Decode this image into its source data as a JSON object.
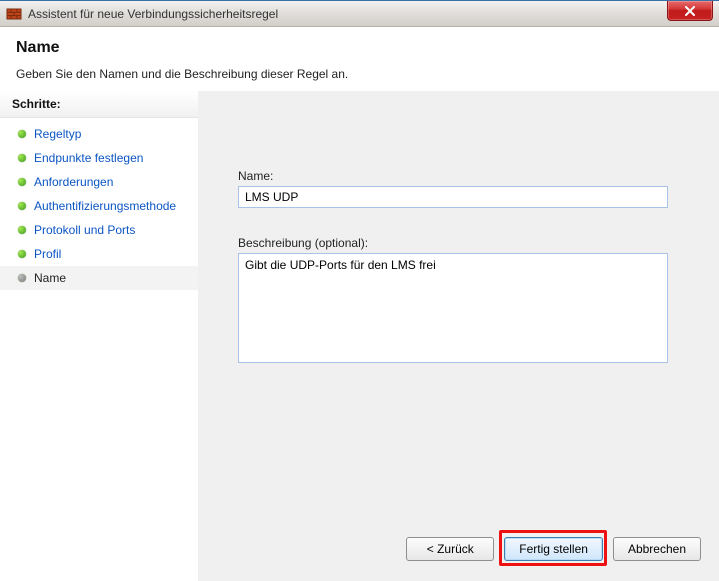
{
  "titlebar": {
    "title": "Assistent für neue Verbindungssicherheitsregel"
  },
  "header": {
    "title": "Name",
    "description": "Geben Sie den Namen und die Beschreibung dieser Regel an."
  },
  "sidebar": {
    "label": "Schritte:",
    "steps": [
      {
        "label": "Regeltyp",
        "current": false
      },
      {
        "label": "Endpunkte festlegen",
        "current": false
      },
      {
        "label": "Anforderungen",
        "current": false
      },
      {
        "label": "Authentifizierungsmethode",
        "current": false
      },
      {
        "label": "Protokoll und Ports",
        "current": false
      },
      {
        "label": "Profil",
        "current": false
      },
      {
        "label": "Name",
        "current": true
      }
    ]
  },
  "main": {
    "name_label": "Name:",
    "name_value": "LMS UDP",
    "desc_label": "Beschreibung (optional):",
    "desc_value": "Gibt die UDP-Ports für den LMS frei"
  },
  "buttons": {
    "back": "< Zurück",
    "finish": "Fertig stellen",
    "cancel": "Abbrechen"
  }
}
